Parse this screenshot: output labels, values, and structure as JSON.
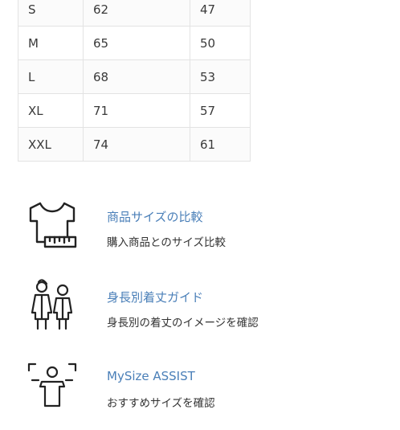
{
  "size_table": {
    "rows": [
      [
        "S",
        "62",
        "47"
      ],
      [
        "M",
        "65",
        "50"
      ],
      [
        "L",
        "68",
        "53"
      ],
      [
        "XL",
        "71",
        "57"
      ],
      [
        "XXL",
        "74",
        "61"
      ]
    ]
  },
  "features": [
    {
      "title": "商品サイズの比較",
      "desc": "購入商品とのサイズ比較",
      "icon": "tshirt-ruler-icon"
    },
    {
      "title": "身長別着丈ガイド",
      "desc": "身長別の着丈のイメージを確認",
      "icon": "two-people-icon"
    },
    {
      "title": "MySize ASSIST",
      "desc": "おすすめサイズを確認",
      "icon": "person-scan-icon"
    }
  ],
  "colors": {
    "link": "#4a7fb8",
    "border": "#e3e3e3",
    "text": "#333333"
  }
}
